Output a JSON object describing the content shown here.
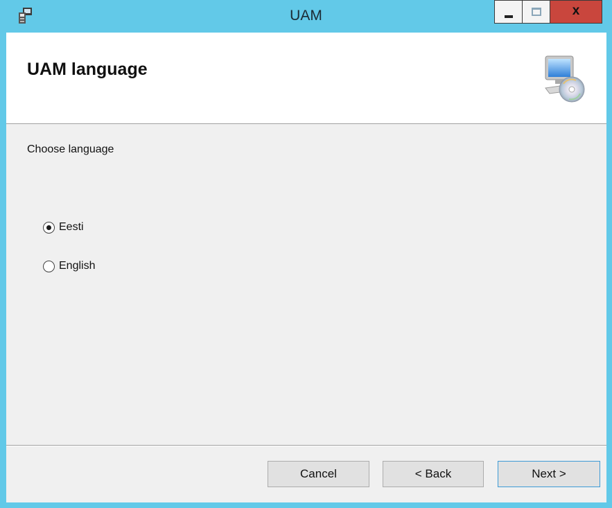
{
  "window": {
    "title": "UAM",
    "controls": {
      "minimize_icon": "minimize-icon",
      "maximize_icon": "maximize-icon",
      "close_label": "x"
    },
    "colors": {
      "titlebar": "#62c9e8",
      "close_button": "#c9463d"
    }
  },
  "header": {
    "title": "UAM language",
    "icon": "computer-cd-icon"
  },
  "content": {
    "prompt": "Choose language",
    "options": [
      {
        "label": "Eesti",
        "selected": true
      },
      {
        "label": "English",
        "selected": false
      }
    ]
  },
  "buttons": {
    "cancel": "Cancel",
    "back": "< Back",
    "next": "Next >"
  }
}
